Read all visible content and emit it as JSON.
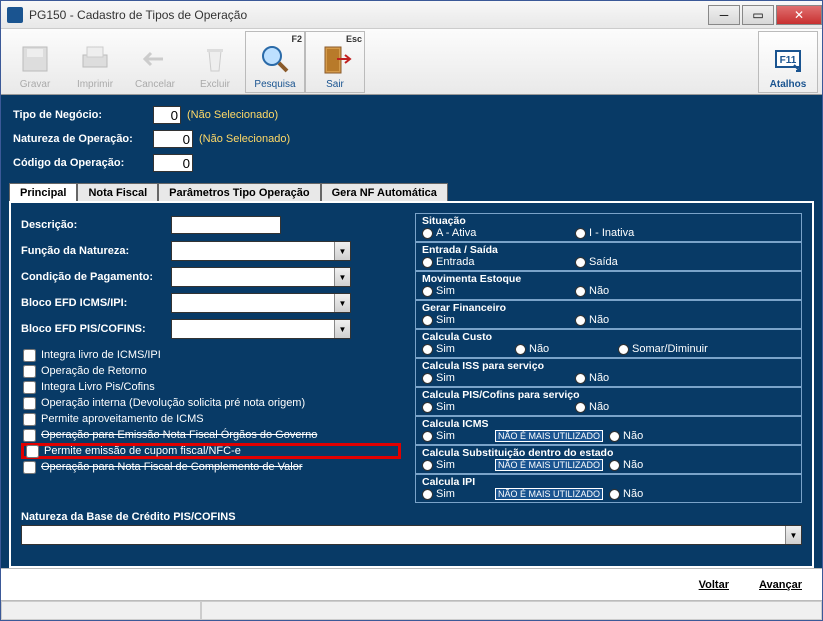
{
  "window": {
    "title": "PG150 - Cadastro de Tipos de Operação"
  },
  "toolbar": {
    "gravar": "Gravar",
    "imprimir": "Imprimir",
    "cancelar": "Cancelar",
    "excluir": "Excluir",
    "pesquisa": "Pesquisa",
    "sair": "Sair",
    "atalhos": "Atalhos",
    "sc_f2": "F2",
    "sc_esc": "Esc",
    "sc_f11": "F11"
  },
  "header": {
    "tipo_negocio": {
      "label": "Tipo de Negócio:",
      "value": "0",
      "hint": "(Não Selecionado)"
    },
    "natureza": {
      "label": "Natureza de Operação:",
      "value": "0",
      "hint": "(Não Selecionado)"
    },
    "codigo": {
      "label": "Código da Operação:",
      "value": "0"
    }
  },
  "tabs": {
    "principal": "Principal",
    "nota_fiscal": "Nota Fiscal",
    "parametros": "Parâmetros Tipo Operação",
    "gera_nf": "Gera NF Automática"
  },
  "left": {
    "descricao": "Descrição:",
    "funcao_natureza": "Função da Natureza:",
    "cond_pagamento": "Condição de Pagamento:",
    "bloco_icms": "Bloco EFD ICMS/IPI:",
    "bloco_pis": "Bloco EFD PIS/COFINS:",
    "checks": {
      "integra_icms": "Integra livro de ICMS/IPI",
      "op_retorno": "Operação de Retorno",
      "integra_pis": "Integra Livro Pis/Cofins",
      "op_interna": "Operação interna (Devolução solicita pré nota origem)",
      "permite_icms": "Permite aproveitamento de ICMS",
      "op_emissao_gov": "Operação para Emissão Nota Fiscal Órgãos do Governo",
      "permite_cupom": "Permite emissão de cupom fiscal/NFC-e",
      "op_complemento": "Operação para Nota Fiscal de Complemento de Valor"
    }
  },
  "right": {
    "situacao": {
      "legend": "Situação",
      "a": "A - Ativa",
      "i": "I - Inativa"
    },
    "entrada_saida": {
      "legend": "Entrada / Saída",
      "e": "Entrada",
      "s": "Saída"
    },
    "mov_estoque": {
      "legend": "Movimenta Estoque",
      "s": "Sim",
      "n": "Não"
    },
    "gerar_fin": {
      "legend": "Gerar Financeiro",
      "s": "Sim",
      "n": "Não"
    },
    "calc_custo": {
      "legend": "Calcula Custo",
      "s": "Sim",
      "n": "Não",
      "sd": "Somar/Diminuir"
    },
    "calc_iss": {
      "legend": "Calcula ISS para serviço",
      "s": "Sim",
      "n": "Não"
    },
    "calc_pis_serv": {
      "legend": "Calcula PIS/Cofins para serviço",
      "s": "Sim",
      "n": "Não"
    },
    "calc_icms2": {
      "legend": "Calcula ICMS",
      "s": "Sim",
      "n": "Não",
      "badge": "NÃO É MAIS UTILIZADO"
    },
    "calc_sub": {
      "legend": "Calcula Substituição dentro do estado",
      "s": "Sim",
      "n": "Não",
      "badge": "NÃO É MAIS UTILIZADO"
    },
    "calc_ipi": {
      "legend": "Calcula IPI",
      "s": "Sim",
      "n": "Não",
      "badge": "NÃO É MAIS UTILIZADO"
    }
  },
  "bottom": {
    "nat_base_label": "Natureza da Base de Crédito PIS/COFINS"
  },
  "footer": {
    "voltar": "Voltar",
    "avancar": "Avançar"
  }
}
